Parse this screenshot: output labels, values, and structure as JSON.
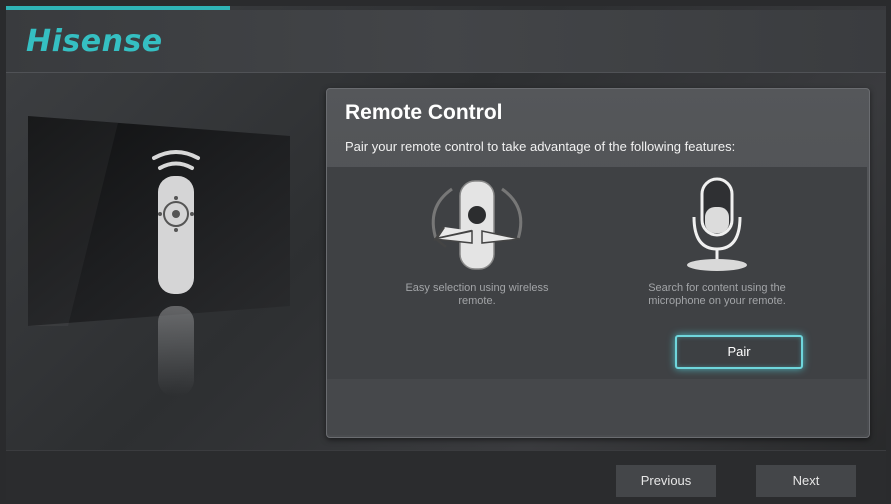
{
  "brand": {
    "logo_text": "Hisense",
    "accent_color": "#35bfc2"
  },
  "dialog": {
    "title": "Remote Control",
    "subtitle": "Pair your remote control to take advantage of the following features:",
    "features": [
      {
        "icon": "remote-gesture-icon",
        "caption_line1": "Easy selection using wireless",
        "caption_line2": "remote."
      },
      {
        "icon": "microphone-icon",
        "caption_line1": "Search for content using the",
        "caption_line2": "microphone on your remote."
      }
    ],
    "pair_label": "Pair"
  },
  "illustration": {
    "icon": "remote-control-icon"
  },
  "footer": {
    "previous_label": "Previous",
    "next_label": "Next"
  }
}
